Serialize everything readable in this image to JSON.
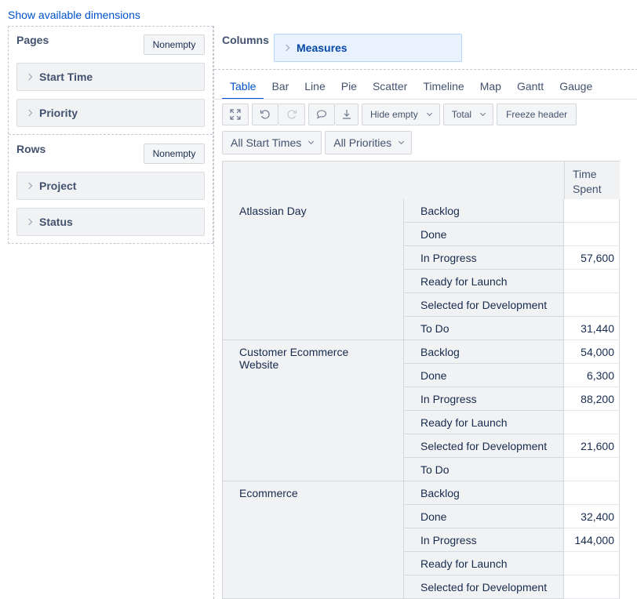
{
  "top_link": "Show available dimensions",
  "left": {
    "pages_title": "Pages",
    "rows_title": "Rows",
    "nonempty_label": "Nonempty",
    "pages_items": [
      "Start Time",
      "Priority"
    ],
    "rows_items": [
      "Project",
      "Status"
    ]
  },
  "columns": {
    "title": "Columns",
    "measure": "Measures"
  },
  "tabs": [
    "Table",
    "Bar",
    "Line",
    "Pie",
    "Scatter",
    "Timeline",
    "Map",
    "Gantt",
    "Gauge"
  ],
  "toolbar": {
    "hide_empty": "Hide empty",
    "total": "Total",
    "freeze_header": "Freeze header"
  },
  "filters": {
    "start_times": "All Start Times",
    "priorities": "All Priorities"
  },
  "table": {
    "header": "Time Spent",
    "groups": [
      {
        "name": "Atlassian Day",
        "rows": [
          {
            "status": "Backlog",
            "value": ""
          },
          {
            "status": "Done",
            "value": ""
          },
          {
            "status": "In Progress",
            "value": "57,600"
          },
          {
            "status": "Ready for Launch",
            "value": ""
          },
          {
            "status": "Selected for Development",
            "value": ""
          },
          {
            "status": "To Do",
            "value": "31,440"
          }
        ]
      },
      {
        "name": "Customer Ecommerce Website",
        "rows": [
          {
            "status": "Backlog",
            "value": "54,000"
          },
          {
            "status": "Done",
            "value": "6,300"
          },
          {
            "status": "In Progress",
            "value": "88,200"
          },
          {
            "status": "Ready for Launch",
            "value": ""
          },
          {
            "status": "Selected for Development",
            "value": "21,600"
          },
          {
            "status": "To Do",
            "value": ""
          }
        ]
      },
      {
        "name": "Ecommerce",
        "rows": [
          {
            "status": "Backlog",
            "value": ""
          },
          {
            "status": "Done",
            "value": "32,400"
          },
          {
            "status": "In Progress",
            "value": "144,000"
          },
          {
            "status": "Ready for Launch",
            "value": ""
          },
          {
            "status": "Selected for Development",
            "value": ""
          }
        ]
      }
    ]
  }
}
